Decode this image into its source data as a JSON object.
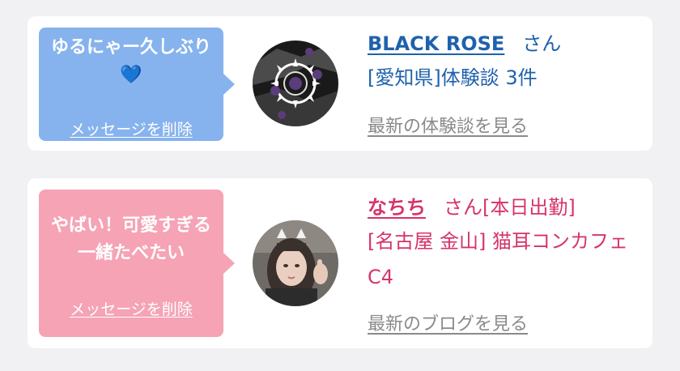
{
  "cards": [
    {
      "message": "ゆるにゃー久しぶり💙",
      "delete_label": "メッセージを削除",
      "name": "BLACK ROSE",
      "honorific": "さん",
      "detail": "[愛知県]体験談 3件",
      "latest_label": "最新の体験談を見る",
      "theme": "#86b3ee",
      "text_color": "#1f61ad"
    },
    {
      "message": "やばい！可愛すぎる一緒たべたい",
      "delete_label": "メッセージを削除",
      "name": "なちち",
      "honorific": "さん",
      "status": "[本日出勤]",
      "detail": "[名古屋 金山] 猫耳コンカフェ C4",
      "latest_label": "最新のブログを見る",
      "theme": "#f5a3b5",
      "text_color": "#d6336c"
    }
  ]
}
